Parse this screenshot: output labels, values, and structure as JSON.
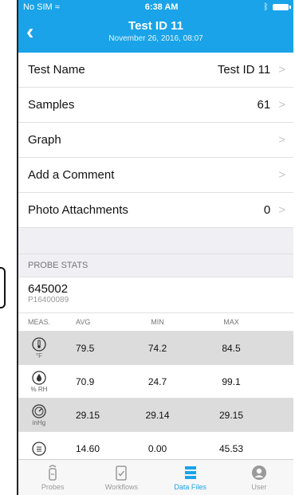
{
  "status_bar": {
    "carrier": "No SIM",
    "time": "6:38 AM"
  },
  "nav": {
    "title": "Test ID 11",
    "subtitle": "November 26, 2016, 08:07"
  },
  "rows": [
    {
      "label": "Test Name",
      "value": "Test ID 11"
    },
    {
      "label": "Samples",
      "value": "61"
    },
    {
      "label": "Graph",
      "value": ""
    },
    {
      "label": "Add a Comment",
      "value": ""
    },
    {
      "label": "Photo Attachments",
      "value": "0"
    }
  ],
  "probe_stats": {
    "section_title": "PROBE STATS",
    "probe_id": "645002",
    "probe_serial": "P16400089",
    "columns": [
      "MEAS.",
      "AVG",
      "MIN",
      "MAX"
    ],
    "rows": [
      {
        "icon": "thermometer-icon",
        "unit": "°F",
        "avg": "79.5",
        "min": "74.2",
        "max": "84.5"
      },
      {
        "icon": "humidity-drop-icon",
        "unit": "% RH",
        "avg": "70.9",
        "min": "24.7",
        "max": "99.1"
      },
      {
        "icon": "pressure-gauge-icon",
        "unit": "inHg",
        "avg": "29.15",
        "min": "29.14",
        "max": "29.15"
      },
      {
        "icon": "partial-row-icon",
        "unit": "",
        "avg": "14.60",
        "min": "0.00",
        "max": "45.53"
      }
    ]
  },
  "tabs": [
    {
      "label": "Probes",
      "icon": "probe-icon"
    },
    {
      "label": "Workflows",
      "icon": "clipboard-check-icon"
    },
    {
      "label": "Data Files",
      "icon": "data-files-icon",
      "active": true
    },
    {
      "label": "User",
      "icon": "user-icon"
    }
  ],
  "colors": {
    "accent": "#1aa3e8"
  }
}
